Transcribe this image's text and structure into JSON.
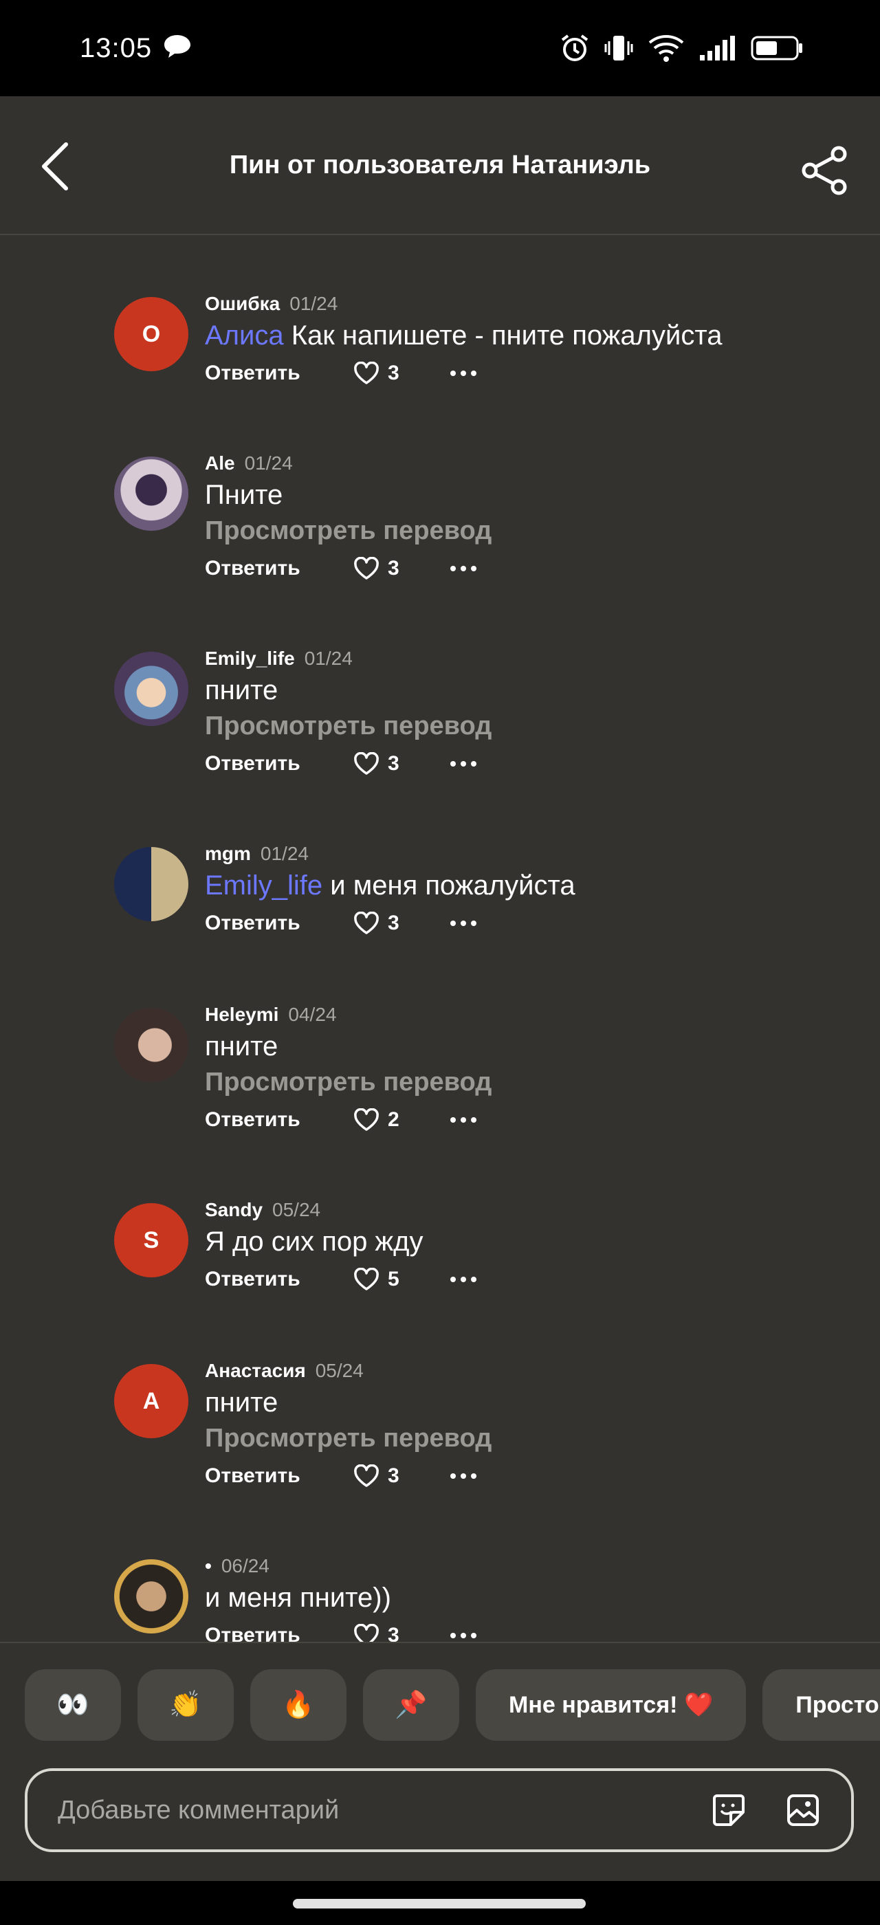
{
  "status_bar": {
    "time": "13:05"
  },
  "header": {
    "title": "Пин от пользователя Натаниэль"
  },
  "comments": [
    {
      "username": "Ошибка",
      "date": "01/24",
      "avatar_letter": "О",
      "mention": "Алиса",
      "text": " Как напишете - пните пожалуйста",
      "translate": "",
      "reply": "Ответить",
      "likes": "3"
    },
    {
      "username": "Ale",
      "date": "01/24",
      "avatar_letter": "",
      "mention": "",
      "text": "Пните",
      "translate": "Просмотреть перевод",
      "reply": "Ответить",
      "likes": "3"
    },
    {
      "username": "Emily_life",
      "date": "01/24",
      "avatar_letter": "",
      "mention": "",
      "text": "пните",
      "translate": "Просмотреть перевод",
      "reply": "Ответить",
      "likes": "3"
    },
    {
      "username": "mgm",
      "date": "01/24",
      "avatar_letter": "",
      "mention": "Emily_life",
      "text": " и меня пожалуйста",
      "translate": "",
      "reply": "Ответить",
      "likes": "3"
    },
    {
      "username": "Heleymi",
      "date": "04/24",
      "avatar_letter": "",
      "mention": "",
      "text": "пните",
      "translate": "Просмотреть перевод",
      "reply": "Ответить",
      "likes": "2"
    },
    {
      "username": "Sandy",
      "date": "05/24",
      "avatar_letter": "S",
      "mention": "",
      "text": "Я до сих пор жду",
      "translate": "",
      "reply": "Ответить",
      "likes": "5"
    },
    {
      "username": "Анастасия",
      "date": "05/24",
      "avatar_letter": "А",
      "mention": "",
      "text": "пните",
      "translate": "Просмотреть перевод",
      "reply": "Ответить",
      "likes": "3"
    },
    {
      "username": "•",
      "date": "06/24",
      "avatar_letter": "",
      "mention": "",
      "text": "и меня пните))",
      "translate": "",
      "reply": "Ответить",
      "likes": "3"
    }
  ],
  "reactions": [
    "👀",
    "👏",
    "🔥",
    "📌",
    "Мне нравится! ❤️",
    "Просто"
  ],
  "comment_input": {
    "placeholder": "Добавьте комментарий"
  },
  "colors": {
    "background": "#33322f",
    "mention": "#6c78ff",
    "avatar_letter_bg": "#c8361f"
  }
}
